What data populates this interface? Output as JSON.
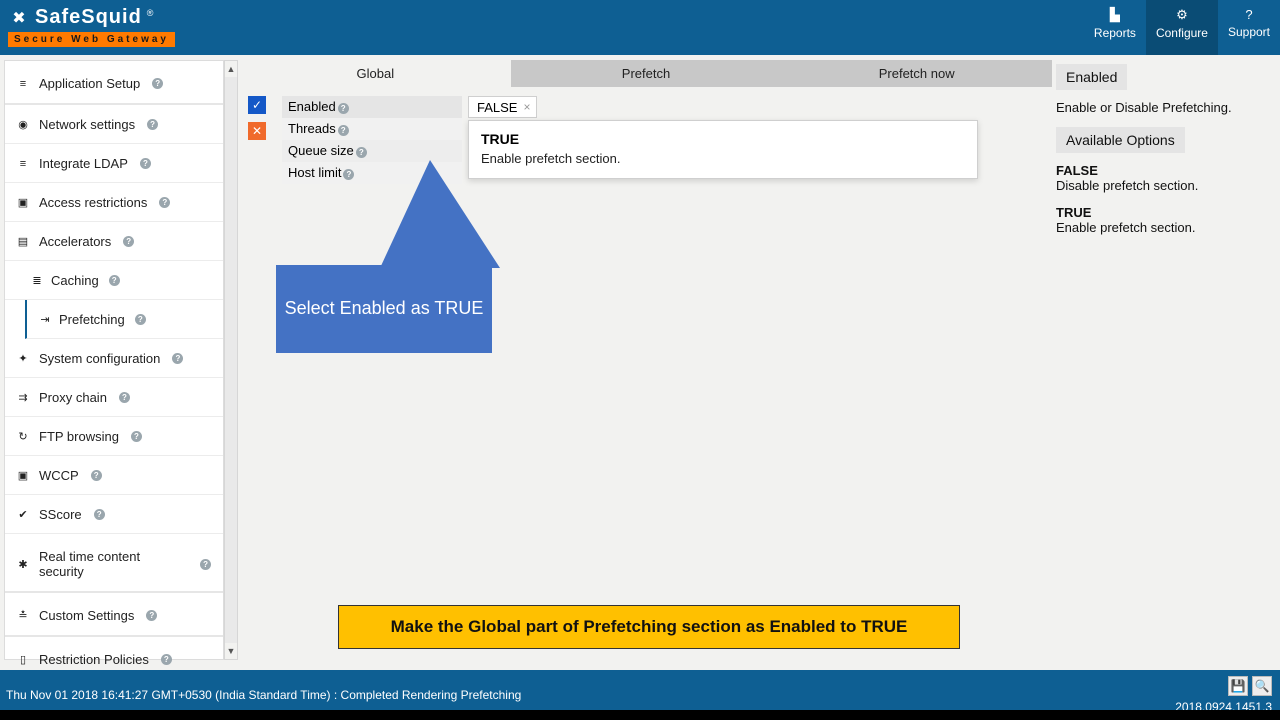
{
  "brand": {
    "name": "SafeSquid",
    "reg": "®",
    "tagline": "Secure Web Gateway"
  },
  "tools": [
    {
      "icon": "reports",
      "label": "Reports",
      "active": false
    },
    {
      "icon": "configure",
      "label": "Configure",
      "active": true
    },
    {
      "icon": "support",
      "label": "Support",
      "active": false
    }
  ],
  "sidebar": {
    "groups": [
      {
        "icon": "stack",
        "label": "Application Setup",
        "help": true,
        "head": true
      },
      {
        "icon": "globe",
        "label": "Network settings",
        "help": true
      },
      {
        "icon": "list",
        "label": "Integrate LDAP",
        "help": true
      },
      {
        "icon": "shield",
        "label": "Access restrictions",
        "help": true
      },
      {
        "icon": "gauge",
        "label": "Accelerators",
        "help": true,
        "children": [
          {
            "icon": "db",
            "label": "Caching",
            "help": true,
            "current": false
          },
          {
            "icon": "step",
            "label": "Prefetching",
            "help": true,
            "current": true
          }
        ]
      },
      {
        "icon": "wrench",
        "label": "System configuration",
        "help": true
      },
      {
        "icon": "chain",
        "label": "Proxy chain",
        "help": true
      },
      {
        "icon": "refresh",
        "label": "FTP browsing",
        "help": true
      },
      {
        "icon": "badge",
        "label": "WCCP",
        "help": true
      },
      {
        "icon": "check",
        "label": "SScore",
        "help": true
      },
      {
        "icon": "bug",
        "label": "Real time content security",
        "help": true,
        "head": true
      },
      {
        "icon": "sliders",
        "label": "Custom Settings",
        "help": true,
        "head": true
      },
      {
        "icon": "lock",
        "label": "Restriction Policies",
        "help": true,
        "head": true
      }
    ]
  },
  "tabs": [
    {
      "label": "Global",
      "active": true
    },
    {
      "label": "Prefetch",
      "active": false
    },
    {
      "label": "Prefetch now",
      "active": false
    }
  ],
  "fields": {
    "enabled": {
      "label": "Enabled",
      "value": "FALSE"
    },
    "threads": {
      "label": "Threads"
    },
    "queue": {
      "label": "Queue size"
    },
    "host": {
      "label": "Host limit"
    }
  },
  "dropdown": {
    "title": "TRUE",
    "desc": "Enable prefetch section."
  },
  "info": {
    "title": "Enabled",
    "desc": "Enable or Disable Prefetching.",
    "avail": "Available Options",
    "opts": [
      {
        "t": "FALSE",
        "d": "Disable prefetch section."
      },
      {
        "t": "TRUE",
        "d": "Enable prefetch section."
      }
    ]
  },
  "callout": "Select Enabled as TRUE",
  "banner": "Make the Global part of Prefetching section as Enabled to TRUE",
  "status": {
    "text": "Thu Nov 01 2018 16:41:27 GMT+0530 (India Standard Time) : Completed Rendering Prefetching",
    "version": "2018.0924.1451.3"
  }
}
